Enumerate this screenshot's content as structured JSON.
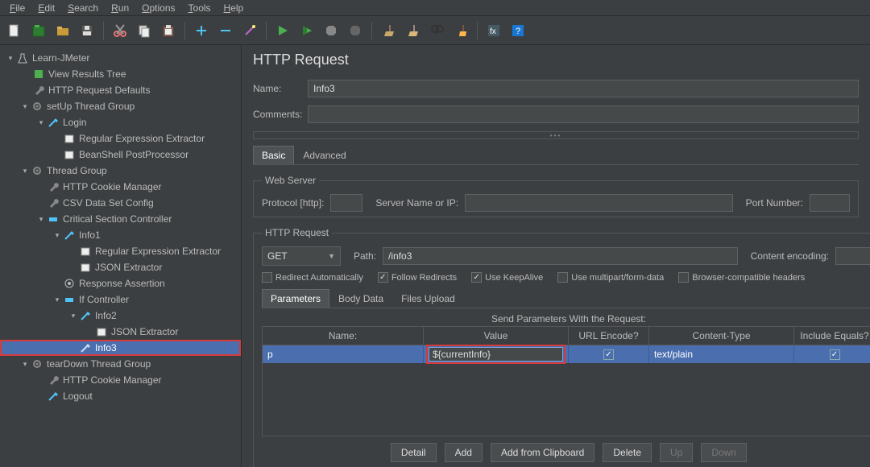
{
  "menu": [
    "File",
    "Edit",
    "Search",
    "Run",
    "Options",
    "Tools",
    "Help"
  ],
  "tree": {
    "root": "Learn-JMeter",
    "items": [
      "View Results Tree",
      "HTTP Request Defaults",
      "setUp Thread Group",
      "Login",
      "Regular Expression Extractor",
      "BeanShell PostProcessor",
      "Thread Group",
      "HTTP Cookie Manager",
      "CSV Data Set Config",
      "Critical Section Controller",
      "Info1",
      "Regular Expression Extractor",
      "JSON Extractor",
      "Response Assertion",
      "If Controller",
      "Info2",
      "JSON Extractor",
      "Info3",
      "tearDown Thread Group",
      "HTTP Cookie Manager",
      "Logout"
    ]
  },
  "panel": {
    "title": "HTTP Request",
    "name_label": "Name:",
    "name_value": "Info3",
    "comments_label": "Comments:",
    "comments_value": "",
    "tabs": {
      "basic": "Basic",
      "advanced": "Advanced"
    },
    "webserver": {
      "legend": "Web Server",
      "protocol_label": "Protocol [http]:",
      "protocol_value": "",
      "server_label": "Server Name or IP:",
      "server_value": "",
      "port_label": "Port Number:",
      "port_value": ""
    },
    "httpreq": {
      "legend": "HTTP Request",
      "method": "GET",
      "path_label": "Path:",
      "path_value": "/info3",
      "encoding_label": "Content encoding:",
      "encoding_value": ""
    },
    "checkboxes": {
      "redirect_auto": {
        "label": "Redirect Automatically",
        "checked": false
      },
      "follow_redirects": {
        "label": "Follow Redirects",
        "checked": true
      },
      "keepalive": {
        "label": "Use KeepAlive",
        "checked": true
      },
      "multipart": {
        "label": "Use multipart/form-data",
        "checked": false
      },
      "browser_compat": {
        "label": "Browser-compatible headers",
        "checked": false
      }
    },
    "subtabs": {
      "params": "Parameters",
      "body": "Body Data",
      "files": "Files Upload"
    },
    "table": {
      "title": "Send Parameters With the Request:",
      "headers": {
        "name": "Name:",
        "value": "Value",
        "enc": "URL Encode?",
        "ct": "Content-Type",
        "eq": "Include Equals?"
      },
      "row": {
        "name": "p",
        "value": "${currentInfo}",
        "enc": true,
        "ct": "text/plain",
        "eq": true
      }
    },
    "buttons": {
      "detail": "Detail",
      "add": "Add",
      "clip": "Add from Clipboard",
      "del": "Delete",
      "up": "Up",
      "down": "Down"
    }
  }
}
